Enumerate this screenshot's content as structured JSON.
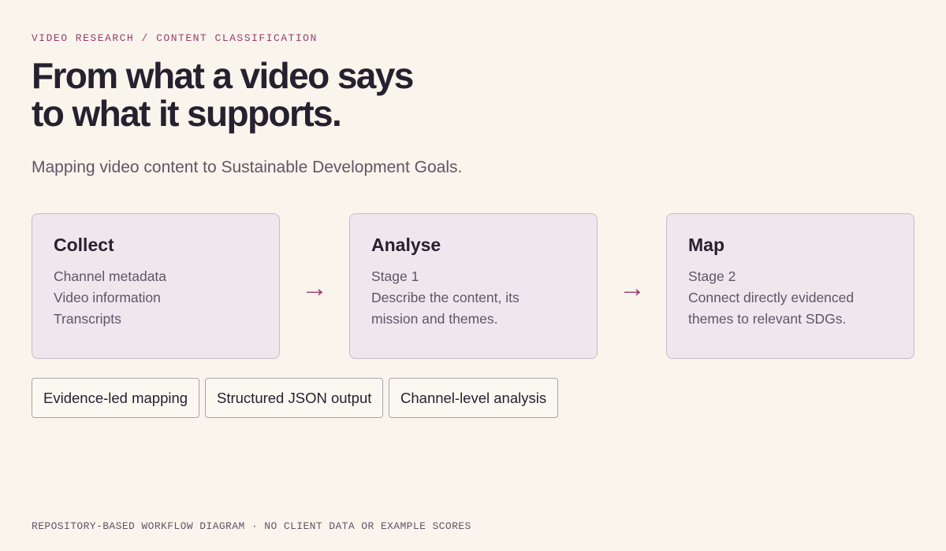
{
  "eyebrow": "VIDEO RESEARCH / CONTENT CLASSIFICATION",
  "headline": {
    "line1": "From what a video says",
    "line2": "to what it supports."
  },
  "subtitle": "Mapping video content to Sustainable Development Goals.",
  "steps": [
    {
      "title": "Collect",
      "lines": [
        "Channel metadata",
        "Video information",
        "Transcripts"
      ]
    },
    {
      "title": "Analyse",
      "lines": [
        "Stage 1",
        "Describe the content, its",
        "mission and themes."
      ]
    },
    {
      "title": "Map",
      "lines": [
        "Stage 2",
        "Connect directly evidenced",
        "themes to relevant SDGs."
      ]
    }
  ],
  "arrow_glyph": "→",
  "tags": [
    "Evidence-led mapping",
    "Structured JSON output",
    "Channel-level analysis"
  ],
  "footer": "REPOSITORY-BASED WORKFLOW DIAGRAM · NO CLIENT DATA OR EXAMPLE SCORES",
  "colors": {
    "background": "#f9f5ec",
    "accent": "#9b3a72",
    "card_fill": "#efe7ee",
    "text_dark": "#26212f",
    "text_muted": "#5d5665"
  },
  "icons": {
    "flow_arrow": "right-arrow-icon"
  }
}
